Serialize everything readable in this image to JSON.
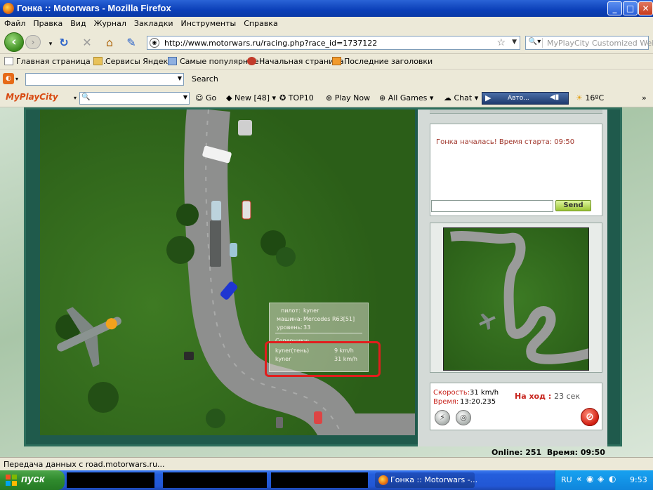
{
  "window": {
    "title": "Гонка :: Motorwars - Mozilla Firefox",
    "min": "_",
    "max": "□",
    "close": "✕"
  },
  "menu": [
    "Файл",
    "Правка",
    "Вид",
    "Журнал",
    "Закладки",
    "Инструменты",
    "Справка"
  ],
  "nav": {
    "url": "http://www.motorwars.ru/racing.php?race_id=1737122",
    "search_placeholder": "MyPlayCity Customized Web"
  },
  "bookmarks": [
    {
      "label": "Главная страница Я..."
    },
    {
      "label": "Сервисы Яндекса"
    },
    {
      "label": "Самые популярные"
    },
    {
      "label": "Начальная страница"
    },
    {
      "label": "Последние заголовки"
    }
  ],
  "toolbar1": {
    "search_button": "Search"
  },
  "toolbar2": {
    "brand": "MyPlayCity",
    "go": "Go",
    "new": "New [48]",
    "top10": "TOP10",
    "playnow": "Play Now",
    "allgames": "All Games",
    "chat": "Chat",
    "player_text": "Авто...",
    "weather": "16ºC",
    "more": "»"
  },
  "chat": {
    "message": "Гонка началась! Время старта: 09:50",
    "send_label": "Send"
  },
  "tooltip": {
    "pilot_label": "пилот:",
    "pilot_value": "kyner",
    "car_label": "машина:",
    "car_value": "Mercedes R63[51]",
    "level_label": "уровень:",
    "level_value": "33",
    "rivals_label": "Соперники:",
    "rivals": [
      {
        "name": "kyner(тень)",
        "speed": "9  km/h"
      },
      {
        "name": "kyner",
        "speed": "31  km/h"
      }
    ]
  },
  "stats": {
    "speed_label": "Скорость:",
    "speed_value": "31 km/h",
    "time_label": "Время:",
    "time_value": "13:20.235",
    "move_label": "На ход :",
    "move_value": "23 сек"
  },
  "footer": {
    "online": "Online: 251",
    "time": "Время: 09:50"
  },
  "status": "Передача данных с road.motorwars.ru...",
  "taskbar": {
    "start": "пуск",
    "firefox_task": "Гонка :: Motorwars -...",
    "lang": "RU",
    "clock": "9:53"
  }
}
